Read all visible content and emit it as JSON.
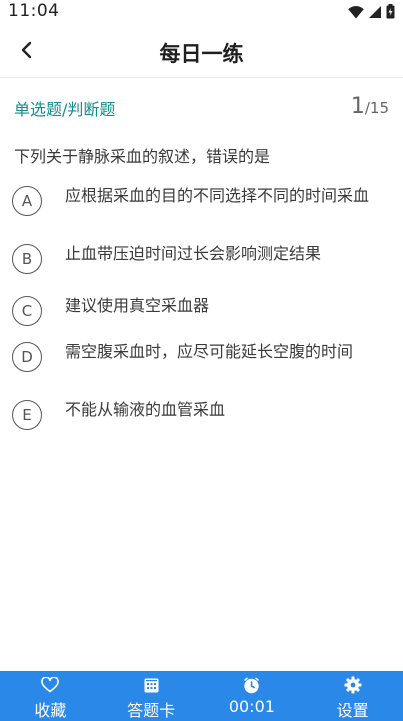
{
  "status_bar": {
    "time": "11:04",
    "icons": [
      "wifi-icon",
      "signal-icon",
      "battery-icon"
    ]
  },
  "nav": {
    "title": "每日一练",
    "back_icon": "chevron-left-icon"
  },
  "question": {
    "type_label": "单选题/判断题",
    "current": "1",
    "separator": "/",
    "total": "15",
    "text": "下列关于静脉采血的叙述，错误的是",
    "options": [
      {
        "letter": "A",
        "text": "应根据采血的目的不同选择不同的时间采血"
      },
      {
        "letter": "B",
        "text": "止血带压迫时间过长会影响测定结果"
      },
      {
        "letter": "C",
        "text": "建议使用真空采血器"
      },
      {
        "letter": "D",
        "text": "需空腹采血时，应尽可能延长空腹的时间"
      },
      {
        "letter": "E",
        "text": "不能从输液的血管采血"
      }
    ]
  },
  "bottom_bar": {
    "background": "#2a88e8",
    "tabs": [
      {
        "label": "收藏",
        "icon": "heart-icon"
      },
      {
        "label": "答题卡",
        "icon": "answer-card-icon"
      },
      {
        "label": "00:01",
        "icon": "clock-icon"
      },
      {
        "label": "设置",
        "icon": "gear-icon"
      }
    ]
  },
  "colors": {
    "accent_teal": "#138f8a",
    "primary_blue": "#2a88e8"
  }
}
